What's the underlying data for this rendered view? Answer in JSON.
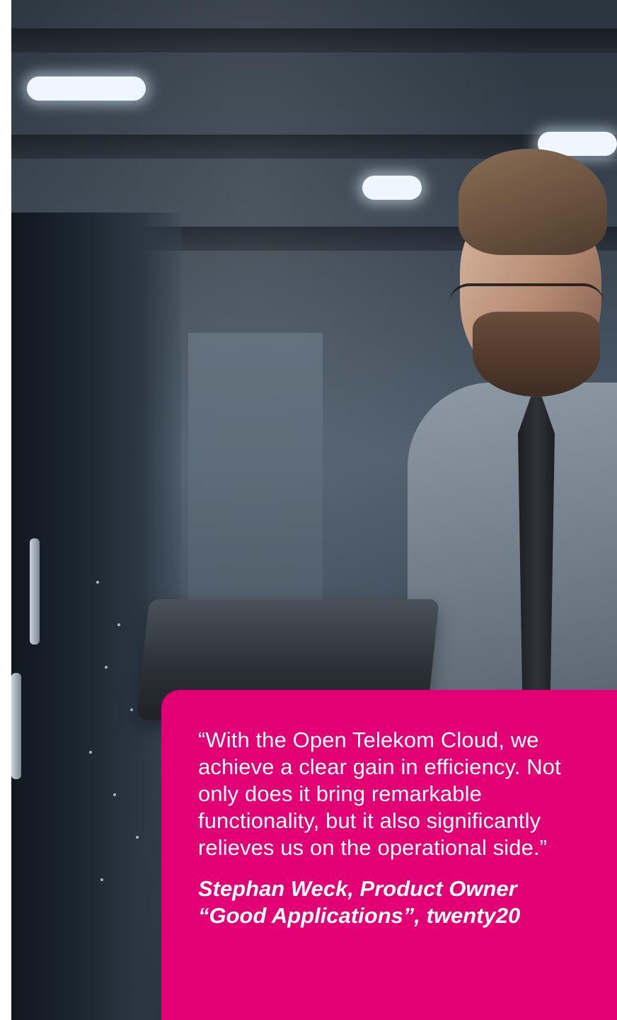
{
  "quote": {
    "text": "“With the Open Telekom Cloud, we achieve a clear gain in efficiency. Not only does it bring remarkable functionality, but it also significantly relieves us on the operational side.”",
    "attribution_line1": "Stephan Weck, Product Owner",
    "attribution_line2": "“Good Applications”, twenty20",
    "card_color": "#e20074",
    "text_color": "#ffffff"
  },
  "photo": {
    "subject": "man with tablet in server room"
  }
}
